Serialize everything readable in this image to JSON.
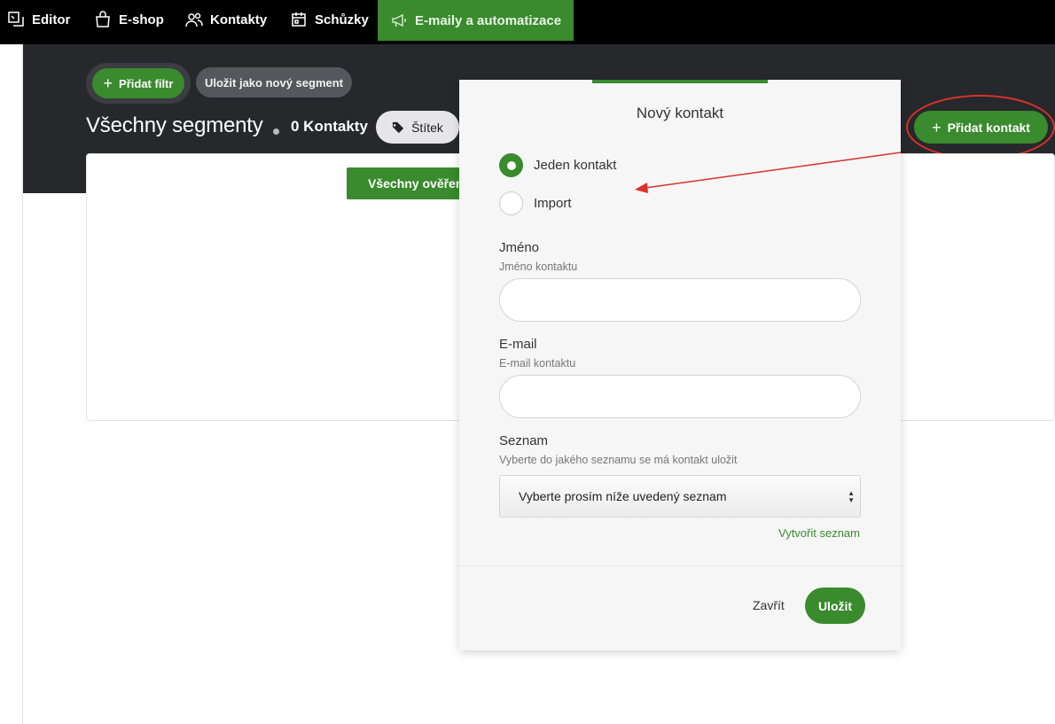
{
  "nav": {
    "items": [
      {
        "label": "Editor",
        "icon": "editor-icon",
        "active": false
      },
      {
        "label": "E-shop",
        "icon": "shopping-bag-icon",
        "active": false
      },
      {
        "label": "Kontakty",
        "icon": "people-icon",
        "active": false
      },
      {
        "label": "Schůzky",
        "icon": "calendar-icon",
        "active": false
      },
      {
        "label": "E-maily a automatizace",
        "icon": "megaphone-icon",
        "active": true
      }
    ]
  },
  "toolbar": {
    "add_filter_label": "Přidat filtr",
    "save_segment_label": "Uložit jako nový segment"
  },
  "header": {
    "title": "Všechny segmenty",
    "contact_count": "0 Kontakty",
    "tag_label": "Štítek",
    "add_contact_label": "Přidat kontakt"
  },
  "panel": {
    "verified_button_label": "Všechny ověřené"
  },
  "modal": {
    "title": "Nový kontakt",
    "radio_options": [
      {
        "label": "Jeden kontakt",
        "checked": true
      },
      {
        "label": "Import",
        "checked": false
      }
    ],
    "name_field": {
      "label": "Jméno",
      "hint": "Jméno kontaktu",
      "value": ""
    },
    "email_field": {
      "label": "E-mail",
      "hint": "E-mail kontaktu",
      "value": ""
    },
    "list_field": {
      "label": "Seznam",
      "hint": "Vyberte do jakého seznamu se má kontakt uložit",
      "selected": "Vyberte prosím níže uvedený seznam"
    },
    "create_list_label": "Vytvořit seznam",
    "close_label": "Zavřít",
    "save_label": "Uložit"
  },
  "colors": {
    "accent_green": "#3a8a2e",
    "dark_band": "#26282c",
    "annotation_red": "#d9322a"
  }
}
